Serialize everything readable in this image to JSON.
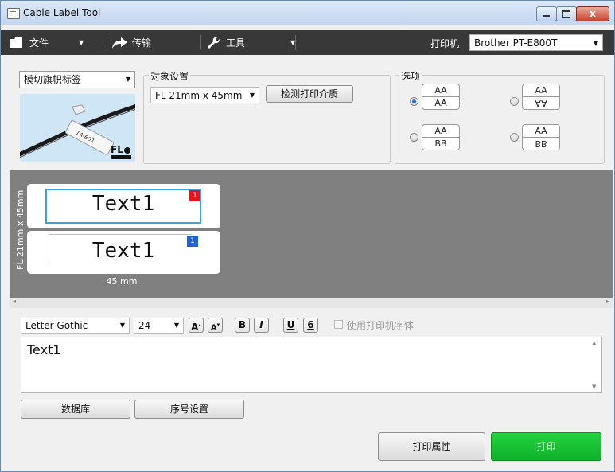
{
  "window": {
    "title": "Cable Label Tool",
    "close_glyph": "x"
  },
  "menu": {
    "file": "文件",
    "transfer": "传输",
    "tools": "工具",
    "printer_label": "打印机",
    "printer_value": "Brother PT-E800T"
  },
  "template": {
    "label_type": "模切旗帜标签",
    "preview_text": "1A-B01",
    "logo": "FL"
  },
  "object_settings": {
    "legend": "对象设置",
    "media_size": "FL 21mm x 45mm",
    "detect_button": "检测打印介质"
  },
  "options": {
    "legend": "选项",
    "choices": [
      {
        "top": "AA",
        "bottom": "AA",
        "selected": true
      },
      {
        "top": "AA",
        "bottom": "AA",
        "selected": false,
        "flipped": true
      },
      {
        "top": "AA",
        "bottom": "BB",
        "selected": false
      },
      {
        "top": "AA",
        "bottom": "BB",
        "selected": false,
        "flipped": true
      }
    ]
  },
  "canvas": {
    "vertical_label": "FL 21mm x 45mm",
    "width_label": "45 mm",
    "labels": [
      {
        "text": "Text1",
        "badge": "1",
        "badge_color": "#e8141d"
      },
      {
        "text": "Text1",
        "badge": "1",
        "badge_color": "#1e63d6"
      }
    ]
  },
  "format": {
    "font": "Letter Gothic",
    "size": "24",
    "grow_label": "A",
    "shrink_label": "A",
    "bold_label": "B",
    "italic_label": "I",
    "underline_label": "U",
    "frame_label": "6",
    "use_printer_font": "使用打印机字体"
  },
  "editor": {
    "text": "Text1"
  },
  "buttons": {
    "database": "数据库",
    "numbering": "序号设置",
    "print_properties": "打印属性",
    "print": "打印"
  },
  "colors": {
    "accent": "#0fb02a",
    "menubar": "#383838",
    "canvas_bg": "#808080"
  }
}
